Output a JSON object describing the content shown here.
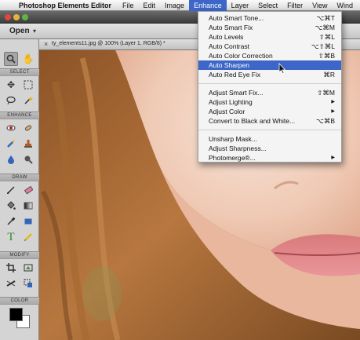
{
  "menubar": {
    "app_name": "Photoshop Elements Editor",
    "items": [
      "File",
      "Edit",
      "Image",
      "Enhance",
      "Layer",
      "Select",
      "Filter",
      "View",
      "Wind"
    ],
    "active": "Enhance"
  },
  "options_bar": {
    "open_label": "Open"
  },
  "document": {
    "tab_title": "ty_elements11.jpg @ 100% (Layer 1, RGB/8) *"
  },
  "toolbox": {
    "sections": {
      "select": "SELECT",
      "enhance": "ENHANCE",
      "draw": "DRAW",
      "modify": "MODIFY",
      "color": "COLOR"
    },
    "tools": [
      "zoom-icon",
      "hand-icon",
      "move-icon",
      "marquee-icon",
      "lasso-icon",
      "magic-wand-icon",
      "red-eye-icon",
      "spot-heal-icon",
      "smart-brush-icon",
      "clone-stamp-icon",
      "blur-icon",
      "sponge-icon",
      "brush-icon",
      "eraser-icon",
      "paint-bucket-icon",
      "gradient-icon",
      "eyedropper-icon",
      "shape-icon",
      "type-icon",
      "pencil-icon",
      "crop-icon",
      "recompose-icon",
      "straighten-icon",
      "content-move-icon"
    ],
    "foreground_color": "#000000",
    "background_color": "#ffffff"
  },
  "enhance_menu": {
    "items": [
      {
        "label": "Auto Smart Tone...",
        "shortcut": "⌥⌘T"
      },
      {
        "label": "Auto Smart Fix",
        "shortcut": "⌥⌘M"
      },
      {
        "label": "Auto Levels",
        "shortcut": "⇧⌘L"
      },
      {
        "label": "Auto Contrast",
        "shortcut": "⌥⇧⌘L"
      },
      {
        "label": "Auto Color Correction",
        "shortcut": "⇧⌘B"
      },
      {
        "label": "Auto Sharpen",
        "shortcut": ""
      },
      {
        "label": "Auto Red Eye Fix",
        "shortcut": "⌘R"
      },
      {
        "label": "Adjust Smart Fix...",
        "shortcut": "⇧⌘M"
      },
      {
        "label": "Adjust Lighting",
        "shortcut": ""
      },
      {
        "label": "Adjust Color",
        "shortcut": ""
      },
      {
        "label": "Convert to Black and White...",
        "shortcut": "⌥⌘B"
      },
      {
        "label": "Unsharp Mask...",
        "shortcut": ""
      },
      {
        "label": "Adjust Sharpness...",
        "shortcut": ""
      },
      {
        "label": "Photomerge®...",
        "shortcut": ""
      }
    ],
    "highlighted": "Auto Sharpen",
    "highlight_color": "#3d66c9"
  }
}
